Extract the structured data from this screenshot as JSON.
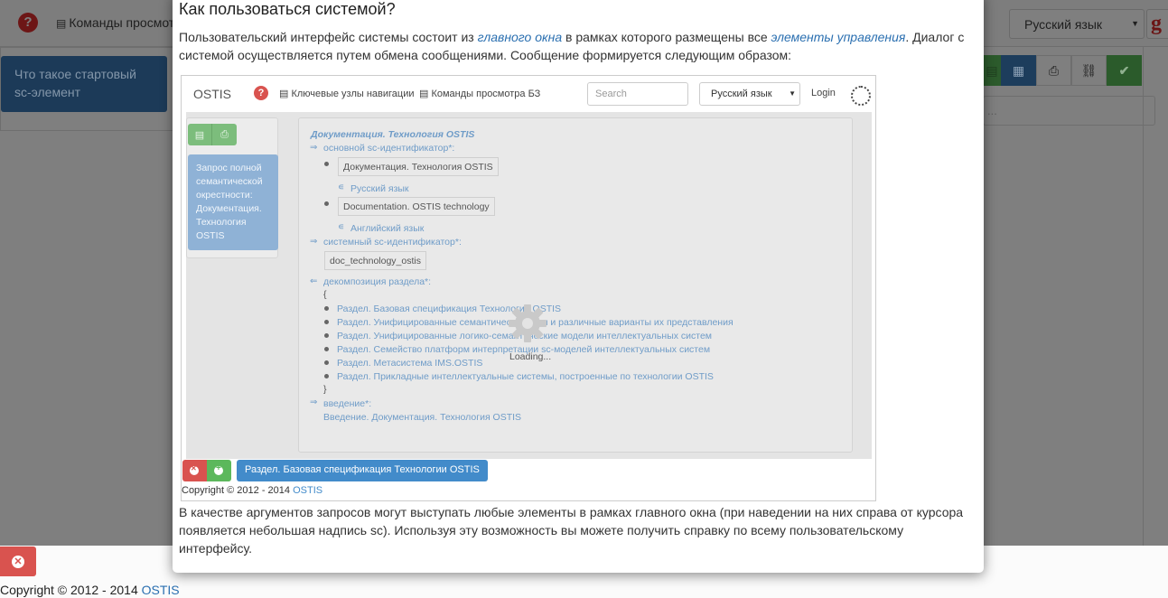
{
  "background": {
    "commands_label": "Команды просмотр",
    "language": "Русский язык",
    "google_label": "g",
    "start_element": "Что такое стартовый sc-элемент",
    "input_placeholder": "...",
    "copyright_prefix": "Copyright © 2012 - 2014",
    "copyright_link": "OSTIS"
  },
  "modal": {
    "title": "Как пользоваться системой?",
    "p1": {
      "part1": "Пользовательский интерфейс системы состоит из ",
      "link1": "главного окна",
      "part2": " в рамках которого размещены все ",
      "link2": "элементы управления",
      "part3": ". Диалог с системой осуществляется путем обмена сообщениями. Сообщение формируется следующим образом:"
    },
    "p2": "В качестве аргументов запросов могут выступать любые элементы в рамках главного окна (при наведении на них справа от курсора появляется небольшая надпись sc). Используя эту возможность вы можете получить справку по всему пользовательскому интерфейсу."
  },
  "screenshot": {
    "brand": "OSTIS",
    "nav1": "Ключевые узлы навигации",
    "nav2": "Команды просмотра БЗ",
    "search_placeholder": "Search",
    "language": "Русский язык",
    "login": "Login",
    "request": "Запрос полной семантической окрестности: Документация. Технология OSTIS",
    "doc_title": "Документация. Технология OSTIS",
    "main_id_label": "основной sc-идентификатор*:",
    "id_ru": "Документация. Технология OSTIS",
    "lang_ru": "Русский язык",
    "id_en": "Documentation. OSTIS technology",
    "lang_en": "Английский язык",
    "sys_id_label": "системный sc-идентификатор*:",
    "sys_id": "doc_technology_ostis",
    "decomp_label": "декомпозиция раздела*:",
    "brace_open": "{",
    "brace_close": "}",
    "sections": [
      "Раздел. Базовая спецификация Технологии OSTIS",
      "Раздел. Унифицированные семантические сети и различные варианты их представления",
      "Раздел. Унифицированные логико-семантические модели интеллектуальных систем",
      "Раздел. Семейство платформ интерпретации sc-моделей интеллектуальных систем",
      "Раздел. Метасистема IMS.OSTIS",
      "Раздел. Прикладные интеллектуальные системы, построенные по технологии OSTIS"
    ],
    "intro_label": "введение*:",
    "intro_value": "Введение. Документация. Технология OSTIS",
    "loading": "Loading...",
    "tab": "Раздел. Базовая спецификация Технологии OSTIS",
    "copyright_prefix": "Copyright © 2012 - 2014 ",
    "copyright_link": "OSTIS"
  }
}
